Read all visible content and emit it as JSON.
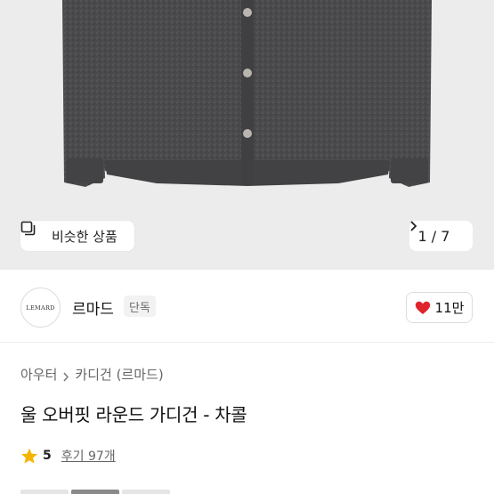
{
  "gallery": {
    "similar_button_label": "비슷한 상품",
    "counter_text": "1 / 7"
  },
  "shop": {
    "logo_text": "LEMARD",
    "name": "르마드",
    "badge": "단독",
    "like_count": "11만",
    "like_color": "#e0242b"
  },
  "breadcrumb": {
    "level1": "아우터",
    "level2": "카디건 (르마드)"
  },
  "product": {
    "title": "울 오버핏 라운드 가디건 - 차콜"
  },
  "rating": {
    "score": "5",
    "reviews": "후기 97개",
    "star_color": "#f5b400"
  },
  "icons": [
    "similar-items-icon",
    "chevron-right-icon",
    "heart-icon",
    "star-icon"
  ]
}
